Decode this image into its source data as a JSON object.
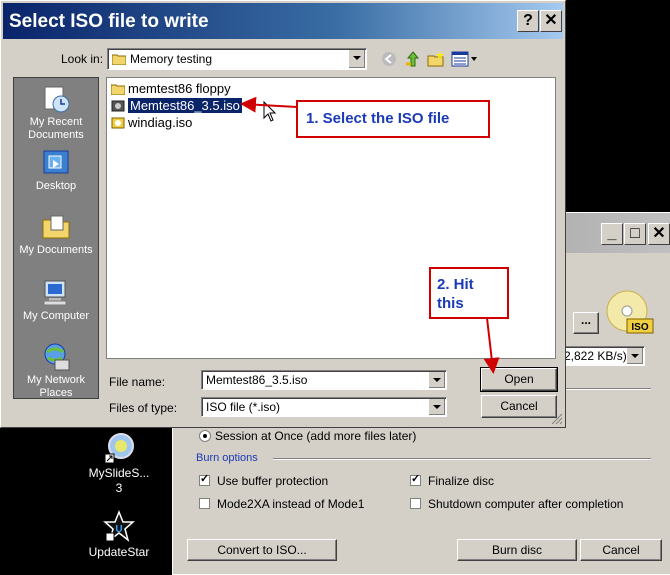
{
  "dialog": {
    "title": "Select ISO file to write",
    "help_btn": "?",
    "close_btn": "✕",
    "look_in_label": "Look in:",
    "look_in_value": "Memory testing",
    "places": [
      {
        "label": "My Recent Documents"
      },
      {
        "label": "Desktop"
      },
      {
        "label": "My Documents"
      },
      {
        "label": "My Computer"
      },
      {
        "label": "My Network Places"
      }
    ],
    "files": [
      {
        "name": "memtest86 floppy",
        "type": "folder"
      },
      {
        "name": "Memtest86_3.5.iso",
        "type": "iso",
        "selected": true
      },
      {
        "name": "windiag.iso",
        "type": "iso"
      }
    ],
    "file_name_label": "File name:",
    "file_name_value": "Memtest86_3.5.iso",
    "files_of_type_label": "Files of type:",
    "files_of_type_value": "ISO file (*.iso)",
    "open_btn": "Open",
    "cancel_btn": "Cancel"
  },
  "callouts": {
    "step1": "1.  Select the ISO file",
    "step2_line1": "2.  Hit",
    "step2_line2": "this"
  },
  "desktop": {
    "icon1_line1": "MySlideS...",
    "icon1_line2": "3",
    "icon2": "UpdateStar"
  },
  "back_window": {
    "ellipsis_btn": "...",
    "speed_value": "2,822 KB/s)",
    "session_label": "Session at Once (add more files later)",
    "burn_options_title": "Burn options",
    "opt_buffer": "Use buffer protection",
    "opt_finalize": "Finalize disc",
    "opt_mode2": "Mode2XA instead of Mode1",
    "opt_shutdown": "Shutdown computer after completion",
    "convert_btn": "Convert to ISO...",
    "burn_btn": "Burn disc",
    "cancel_btn": "Cancel",
    "iso_badge": "ISO",
    "min_btn": "_",
    "max_btn": "□",
    "close_btn": "✕",
    "opt_buffer_checked": true,
    "opt_finalize_checked": true
  },
  "colors": {
    "title_gradient_start": "#0a246a",
    "title_gradient_end": "#a6caf0",
    "callout_border": "#d00000",
    "callout_text": "#1a3ab8",
    "selection": "#0a246a"
  }
}
